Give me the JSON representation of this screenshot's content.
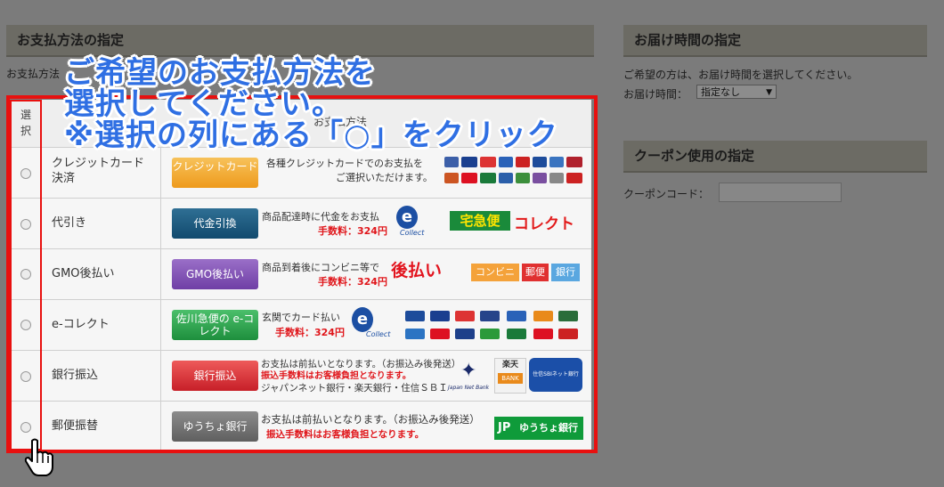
{
  "payment": {
    "title": "お支払方法の指定",
    "intro_visible": "お支払方法",
    "table_header_select": "選択",
    "table_header_method": "お支払方法",
    "rows": [
      {
        "name": "クレジットカード決済",
        "button": "クレジットカード",
        "desc1": "各種クレジットカードでのお支払を",
        "desc2": "ご選択いただけます。",
        "fee": ""
      },
      {
        "name": "代引き",
        "button": "代金引換",
        "desc1": "商品配達時に代金をお支払",
        "desc2": "",
        "fee": "手数料：324円",
        "brand1": "e Collect",
        "brand2": "宅急便コレクト"
      },
      {
        "name": "GMO後払い",
        "button": "GMO後払い",
        "desc1": "商品到着後にコンビニ等で",
        "desc2": "",
        "fee": "手数料：324円",
        "brand1": "後払い",
        "chips": [
          "コンビニ",
          "郵便",
          "銀行"
        ]
      },
      {
        "name": "e-コレクト",
        "button": "佐川急便の e-コレクト",
        "desc1": "玄関でカード払い",
        "desc2": "",
        "fee": "手数料：324円",
        "brand1": "e Collect"
      },
      {
        "name": "銀行振込",
        "button": "銀行振込",
        "desc1": "お支払は前払いとなります。（お振込み後発送）",
        "desc2": "ジャパンネット銀行・楽天銀行・住信ＳＢＩ",
        "fee": "振込手数料はお客様負担となります。",
        "brand1": "Japan Net Bank",
        "brand2": "楽天 BANK",
        "brand3": "住信SBIネット銀行"
      },
      {
        "name": "郵便振替",
        "button": "ゆうちょ銀行",
        "desc1": "お支払は前払いとなります。（お振込み後発送）",
        "desc2": "",
        "fee": "振込手数料はお客様負担となります。",
        "brand1": "ゆうちょ銀行"
      }
    ]
  },
  "delivery": {
    "title": "お届け時間の指定",
    "note": "ご希望の方は、お届け時間を選択してください。",
    "label": "お届け時間：",
    "selected": "指定なし"
  },
  "coupon": {
    "title": "クーポン使用の指定",
    "label": "クーポンコード："
  },
  "callout": {
    "line1": "ご希望のお支払方法を",
    "line2": "選択してください。",
    "line3": "※選択の列にある「○」をクリック"
  },
  "colors": {
    "highlight": "#e8100f",
    "callout": "#2f6fe3"
  }
}
